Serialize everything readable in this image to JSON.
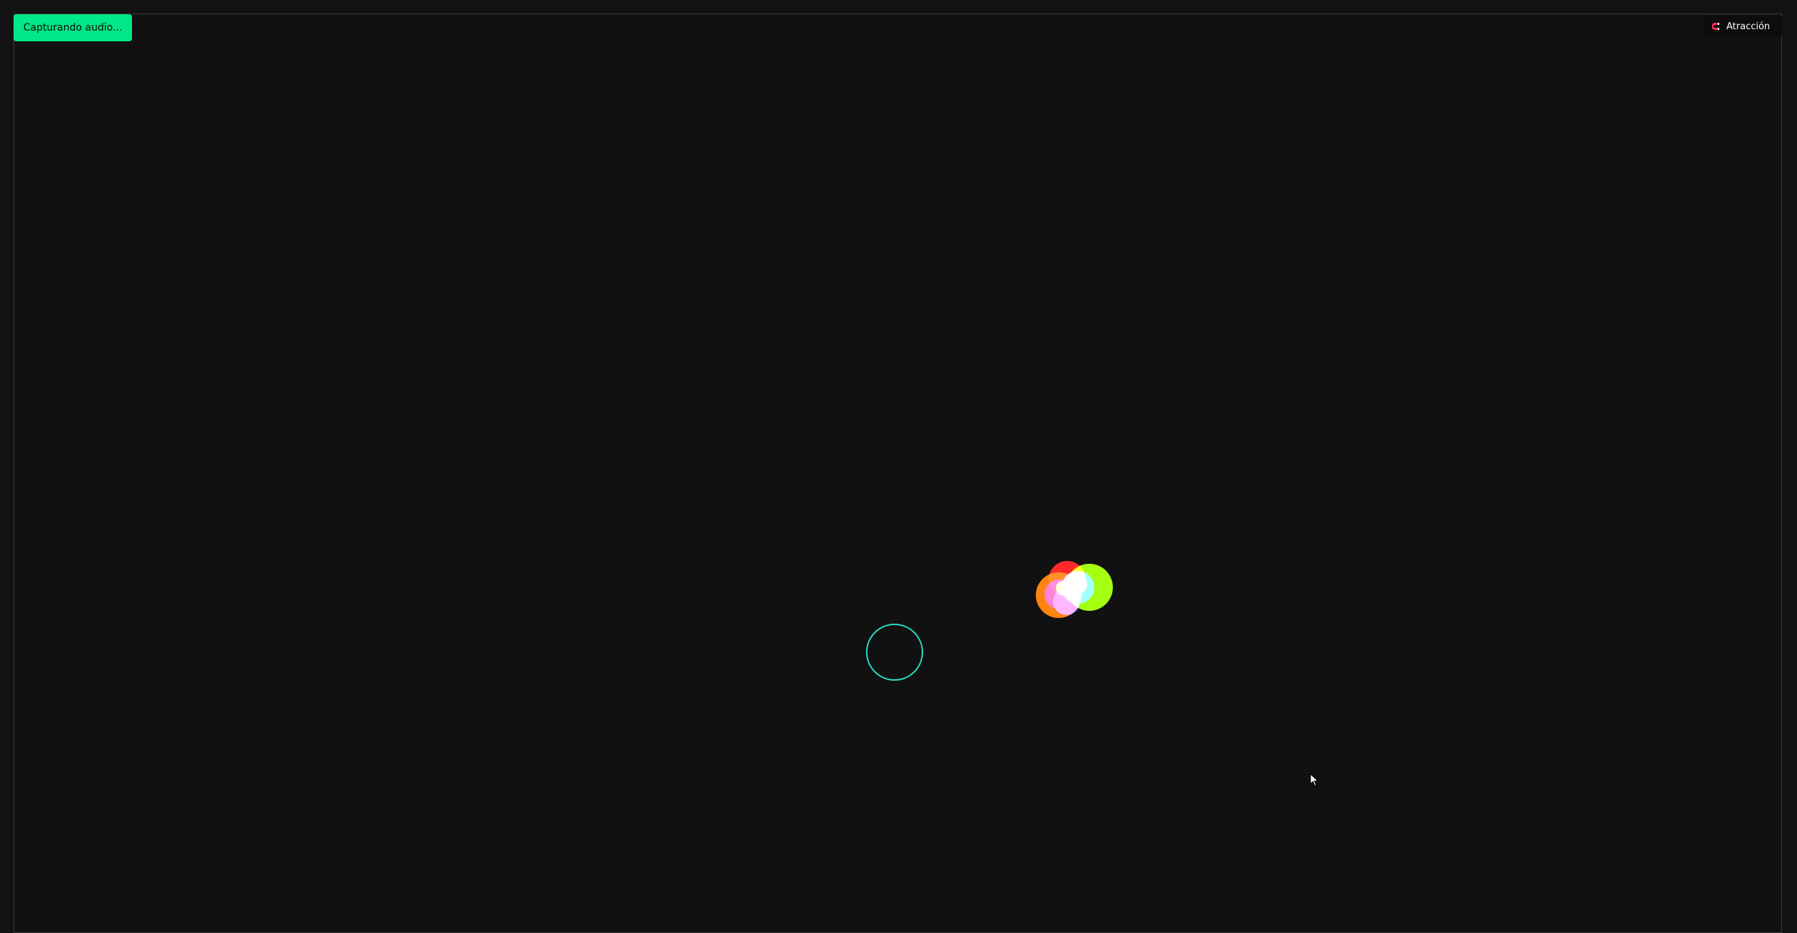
{
  "status_button": {
    "label": "Capturando audio...",
    "color": "#00e887"
  },
  "mode_toggle": {
    "label": "Atracción",
    "icon": "magnet-icon",
    "icon_color": "#ff2a55"
  },
  "canvas": {
    "background": "#111111",
    "cursor_ring_color": "#26e0c8",
    "orb_colors": [
      "#ff7a00",
      "#ff1a1a",
      "#9dff00",
      "#00e5ff",
      "#ff00d4",
      "#2f6bff",
      "#ff2255",
      "#c6ff00"
    ]
  }
}
